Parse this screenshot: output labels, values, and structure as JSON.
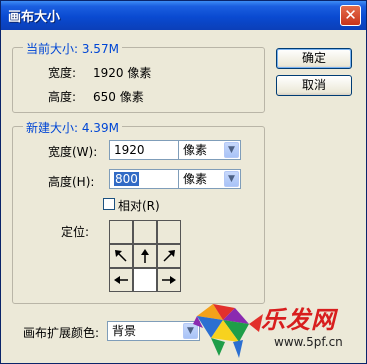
{
  "window": {
    "title": "画布大小"
  },
  "buttons": {
    "ok": "确定",
    "cancel": "取消"
  },
  "current_size": {
    "label": "当前大小: 3.57M",
    "width_label": "宽度:",
    "width_value": "1920 像素",
    "height_label": "高度:",
    "height_value": "650 像素"
  },
  "new_size": {
    "label": "新建大小: 4.39M",
    "width_label": "宽度(W):",
    "width_value": "1920",
    "width_unit": "像素",
    "height_label": "高度(H):",
    "height_value": "800",
    "height_unit": "像素",
    "relative_label": "相对(R)",
    "relative_checked": false,
    "anchor_label": "定位:",
    "anchor_selected": "bottom-center"
  },
  "canvas_extension_color": {
    "label": "画布扩展颜色:",
    "value": "背景"
  },
  "watermark": {
    "brand": "乐发网",
    "url": "www.5pf.cn"
  },
  "colors": {
    "title_bar": "#0a4ad1",
    "group_label": "#0046d5",
    "selection": "#316ac5",
    "watermark": "#d81e1e"
  }
}
